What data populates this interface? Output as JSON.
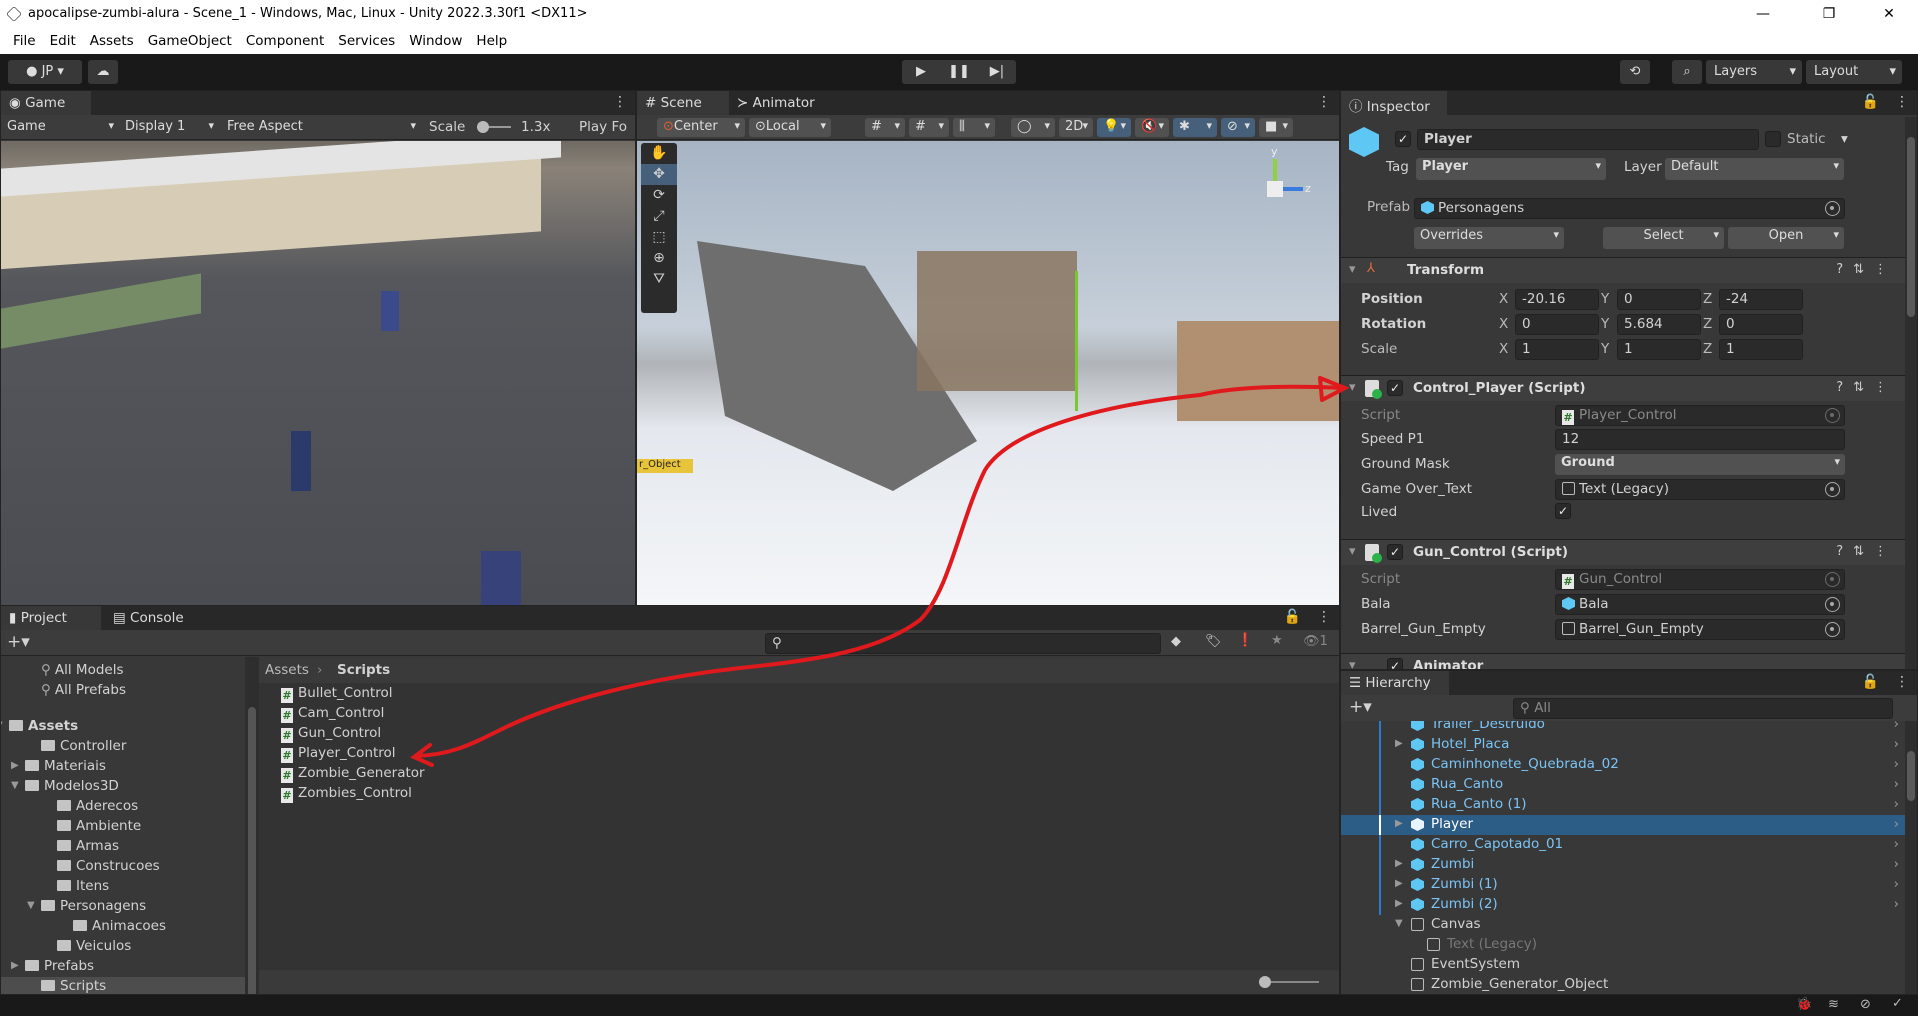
{
  "window": {
    "title": "apocalipse-zumbi-alura - Scene_1 - Windows, Mac, Linux - Unity 2022.3.30f1 <DX11>",
    "minimize": "—",
    "maximize": "❐",
    "close": "✕"
  },
  "menu": [
    "File",
    "Edit",
    "Assets",
    "GameObject",
    "Component",
    "Services",
    "Window",
    "Help"
  ],
  "toolbar": {
    "account": "JP",
    "layers": "Layers",
    "layout": "Layout"
  },
  "game": {
    "tab": "Game",
    "mode": "Game",
    "display": "Display 1",
    "aspect": "Free Aspect",
    "scale_label": "Scale",
    "scale_value": "1.3x",
    "play_focused": "Play Fo"
  },
  "scene": {
    "tabs": [
      "Scene",
      "Animator"
    ],
    "pivot": "Center",
    "space": "Local",
    "two_d": "2D",
    "object_label": "r_Object",
    "gizmo_axes": {
      "y": "y",
      "z": "z"
    }
  },
  "inspector": {
    "tab": "Inspector",
    "object_name": "Player",
    "active": true,
    "static_label": "Static",
    "tag_label": "Tag",
    "tag": "Player",
    "layer_label": "Layer",
    "layer": "Default",
    "prefab_label": "Prefab",
    "prefab": "Personagens",
    "overrides": "Overrides",
    "select": "Select",
    "open": "Open",
    "transform": {
      "title": "Transform",
      "position_label": "Position",
      "rotation_label": "Rotation",
      "scale_label": "Scale",
      "position": {
        "x": "-20.16",
        "y": "0",
        "z": "-24"
      },
      "rotation": {
        "x": "0",
        "y": "5.684",
        "z": "0"
      },
      "scale": {
        "x": "1",
        "y": "1",
        "z": "1"
      },
      "axis_x": "X",
      "axis_y": "Y",
      "axis_z": "Z"
    },
    "control_player": {
      "title": "Control_Player (Script)",
      "script_label": "Script",
      "script": "Player_Control",
      "speed_label": "Speed P1",
      "speed": "12",
      "ground_label": "Ground Mask",
      "ground": "Ground",
      "gameover_label": "Game Over_Text",
      "gameover": "Text (Legacy)",
      "lived_label": "Lived",
      "lived": true
    },
    "gun_control": {
      "title": "Gun_Control (Script)",
      "script_label": "Script",
      "script": "Gun_Control",
      "bala_label": "Bala",
      "bala": "Bala",
      "barrel_label": "Barrel_Gun_Empty",
      "barrel": "Barrel_Gun_Empty"
    },
    "animator": {
      "title": "Animator"
    }
  },
  "hierarchy": {
    "tab": "Hierarchy",
    "search_placeholder": "All",
    "items": [
      {
        "label": "Trailer_Destruido",
        "type": "prefab",
        "indent": 1,
        "arrow": false
      },
      {
        "label": "Hotel_Placa",
        "type": "prefab",
        "indent": 1,
        "arrow": "right"
      },
      {
        "label": "Caminhonete_Quebrada_02",
        "type": "prefab",
        "indent": 1,
        "arrow": false
      },
      {
        "label": "Rua_Canto",
        "type": "prefab",
        "indent": 1,
        "arrow": false
      },
      {
        "label": "Rua_Canto (1)",
        "type": "prefab",
        "indent": 1,
        "arrow": false
      },
      {
        "label": "Player",
        "type": "prefab",
        "indent": 1,
        "arrow": "right",
        "selected": true
      },
      {
        "label": "Carro_Capotado_01",
        "type": "prefab",
        "indent": 1,
        "arrow": false
      },
      {
        "label": "Zumbi",
        "type": "prefab",
        "indent": 1,
        "arrow": "right"
      },
      {
        "label": "Zumbi (1)",
        "type": "prefab",
        "indent": 1,
        "arrow": "right"
      },
      {
        "label": "Zumbi (2)",
        "type": "prefab",
        "indent": 1,
        "arrow": "right"
      },
      {
        "label": "Canvas",
        "type": "object",
        "indent": 1,
        "arrow": "down"
      },
      {
        "label": "Text (Legacy)",
        "type": "disabled",
        "indent": 2,
        "arrow": false
      },
      {
        "label": "EventSystem",
        "type": "object",
        "indent": 1,
        "arrow": false
      },
      {
        "label": "Zombie_Generator_Object",
        "type": "object",
        "indent": 1,
        "arrow": false
      }
    ]
  },
  "project": {
    "tabs": [
      "Project",
      "Console"
    ],
    "hidden_count": "1",
    "breadcrumb": [
      "Assets",
      "Scripts"
    ],
    "tree": [
      {
        "label": "All Models",
        "type": "search",
        "indent": 2
      },
      {
        "label": "All Prefabs",
        "type": "search",
        "indent": 2
      },
      {
        "label": "Assets",
        "type": "open",
        "indent": 0,
        "arrow": "down",
        "bold": true
      },
      {
        "label": "Controller",
        "type": "folder",
        "indent": 2
      },
      {
        "label": "Materiais",
        "type": "folder",
        "indent": 1,
        "arrow": "right"
      },
      {
        "label": "Modelos3D",
        "type": "open",
        "indent": 1,
        "arrow": "down"
      },
      {
        "label": "Aderecos",
        "type": "folder",
        "indent": 3
      },
      {
        "label": "Ambiente",
        "type": "folder",
        "indent": 3
      },
      {
        "label": "Armas",
        "type": "folder",
        "indent": 3
      },
      {
        "label": "Construcoes",
        "type": "folder",
        "indent": 3
      },
      {
        "label": "Itens",
        "type": "folder",
        "indent": 3
      },
      {
        "label": "Personagens",
        "type": "open",
        "indent": 2,
        "arrow": "down"
      },
      {
        "label": "Animacoes",
        "type": "folder",
        "indent": 4
      },
      {
        "label": "Veiculos",
        "type": "folder",
        "indent": 3
      },
      {
        "label": "Prefabs",
        "type": "folder",
        "indent": 1,
        "arrow": "right"
      },
      {
        "label": "Scripts",
        "type": "folder",
        "indent": 2,
        "selected": true
      }
    ],
    "files": [
      "Bullet_Control",
      "Cam_Control",
      "Gun_Control",
      "Player_Control",
      "Zombie_Generator",
      "Zombies_Control"
    ]
  },
  "colors": {
    "accent": "#2c5d87",
    "prefab_blue": "#7bc4f5",
    "annotation_red": "#e0191d"
  }
}
